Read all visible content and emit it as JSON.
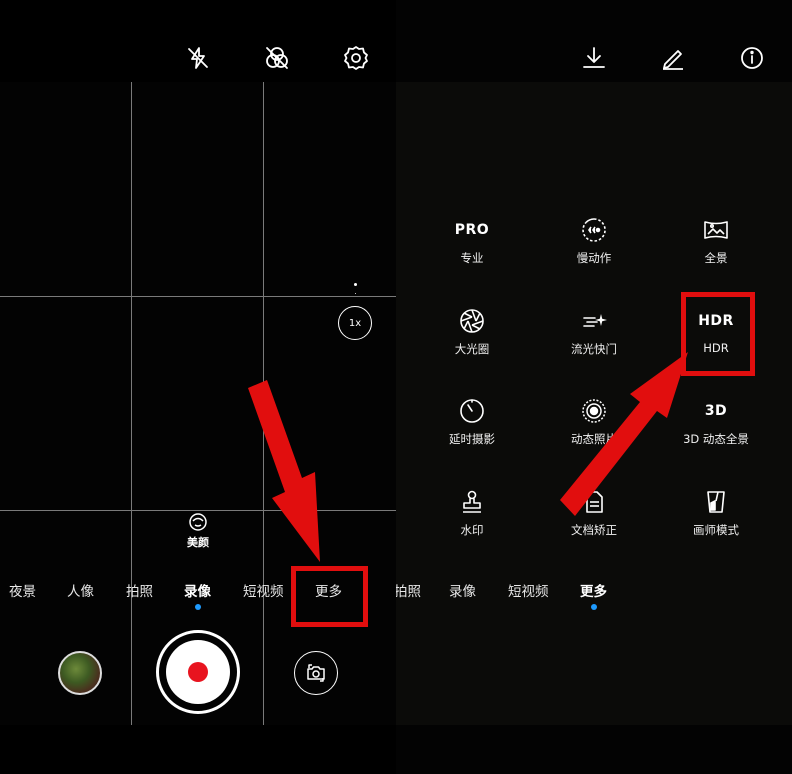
{
  "left": {
    "top_icons": [
      "flash-off-icon",
      "filter-off-icon",
      "settings-icon"
    ],
    "zoom_label": "1x",
    "beauty_label": "美颜",
    "modes": [
      "夜景",
      "人像",
      "拍照",
      "录像",
      "短视频",
      "更多"
    ],
    "active_mode": "录像"
  },
  "right": {
    "top_icons": [
      "download-icon",
      "edit-icon",
      "info-icon"
    ],
    "modes": [
      "拍照",
      "录像",
      "短视频",
      "更多"
    ],
    "active_mode": "更多",
    "grid": [
      {
        "icon": "PRO",
        "label": "专业"
      },
      {
        "icon": "slow-motion-icon",
        "label": "慢动作"
      },
      {
        "icon": "panorama-icon",
        "label": "全景"
      },
      {
        "icon": "aperture-icon",
        "label": "大光圈"
      },
      {
        "icon": "light-trail-icon",
        "label": "流光快门"
      },
      {
        "icon": "HDR",
        "label": "HDR"
      },
      {
        "icon": "timelapse-icon",
        "label": "延时摄影"
      },
      {
        "icon": "moving-picture-icon",
        "label": "动态照片"
      },
      {
        "icon": "3D",
        "label": "3D 动态全景"
      },
      {
        "icon": "stamp-icon",
        "label": "水印"
      },
      {
        "icon": "document-icon",
        "label": "文档矫正"
      },
      {
        "icon": "artist-icon",
        "label": "画师模式"
      }
    ]
  },
  "colors": {
    "highlight": "#e10e0e",
    "record": "#e8141f",
    "active_dot": "#1e9bff"
  }
}
